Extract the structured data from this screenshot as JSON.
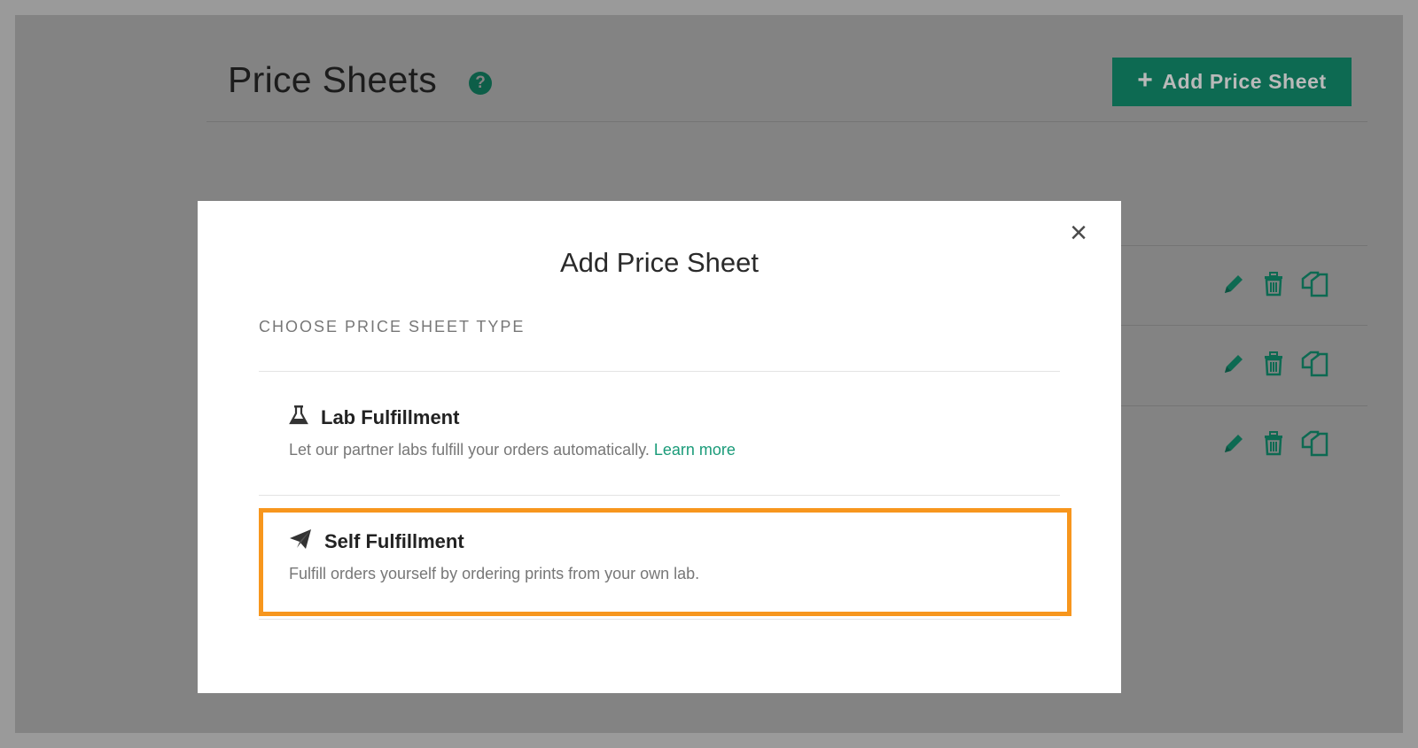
{
  "page": {
    "title": "Price Sheets",
    "add_button_label": "Add Price Sheet",
    "rows": [
      {
        "actions": [
          "pencil-icon",
          "trash-icon",
          "copy-icon"
        ]
      },
      {
        "actions": [
          "pencil-icon",
          "trash-icon",
          "copy-icon"
        ]
      },
      {
        "actions": [
          "pencil-icon",
          "trash-icon",
          "copy-icon"
        ]
      }
    ]
  },
  "modal": {
    "title": "Add Price Sheet",
    "close_label": "×",
    "section_label": "CHOOSE PRICE SHEET TYPE",
    "options": [
      {
        "icon": "flask-icon",
        "title": "Lab Fulfillment",
        "description": "Let our partner labs fulfill your orders automatically.",
        "link": "Learn more"
      },
      {
        "icon": "paper-plane-icon",
        "title": "Self Fulfillment",
        "description": "Fulfill orders yourself by ordering prints from your own lab.",
        "highlighted": true
      }
    ]
  },
  "colors": {
    "brand_green": "#1a9b79",
    "highlight_orange": "#f7961d",
    "overlay": "#838383"
  }
}
